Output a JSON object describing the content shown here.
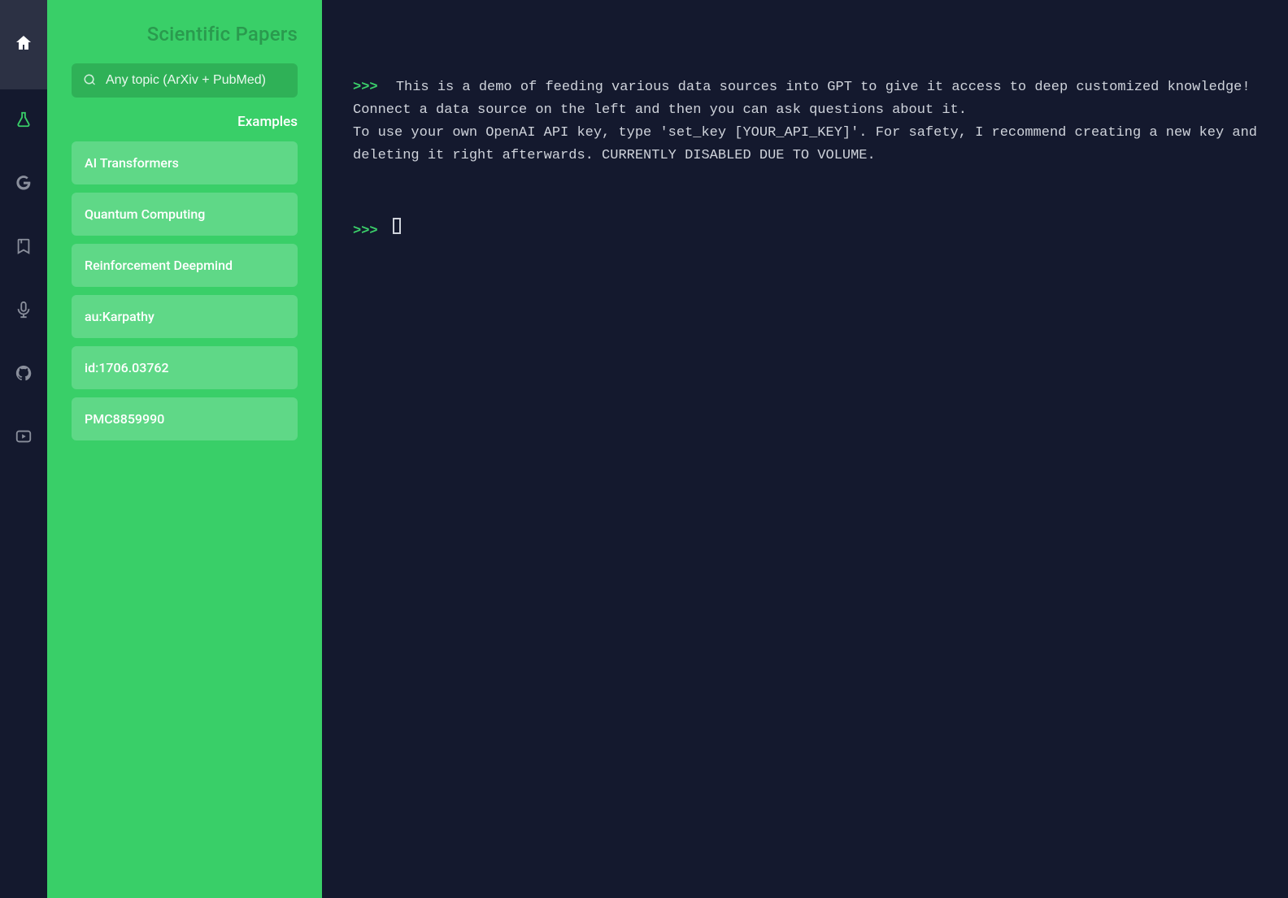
{
  "rail": {
    "items": [
      {
        "name": "home-icon"
      },
      {
        "name": "flask-icon"
      },
      {
        "name": "google-icon"
      },
      {
        "name": "bookmark-icon"
      },
      {
        "name": "microphone-icon"
      },
      {
        "name": "github-icon"
      },
      {
        "name": "youtube-icon"
      }
    ]
  },
  "panel": {
    "title": "Scientific Papers",
    "search_placeholder": "Any topic (ArXiv + PubMed)",
    "examples_header": "Examples",
    "examples": [
      "AI Transformers",
      "Quantum Computing",
      "Reinforcement Deepmind",
      "au:Karpathy",
      "id:1706.03762",
      "PMC8859990"
    ]
  },
  "terminal": {
    "prompt": ">>>",
    "intro": "This is a demo of feeding various data sources into GPT to give it access to deep customized knowledge! Connect a data source on the left and then you can ask questions about it.\nTo use your own OpenAI API key, type 'set_key [YOUR_API_KEY]'. For safety, I recommend creating a new key and deleting it right afterwards. CURRENTLY DISABLED DUE TO VOLUME."
  }
}
